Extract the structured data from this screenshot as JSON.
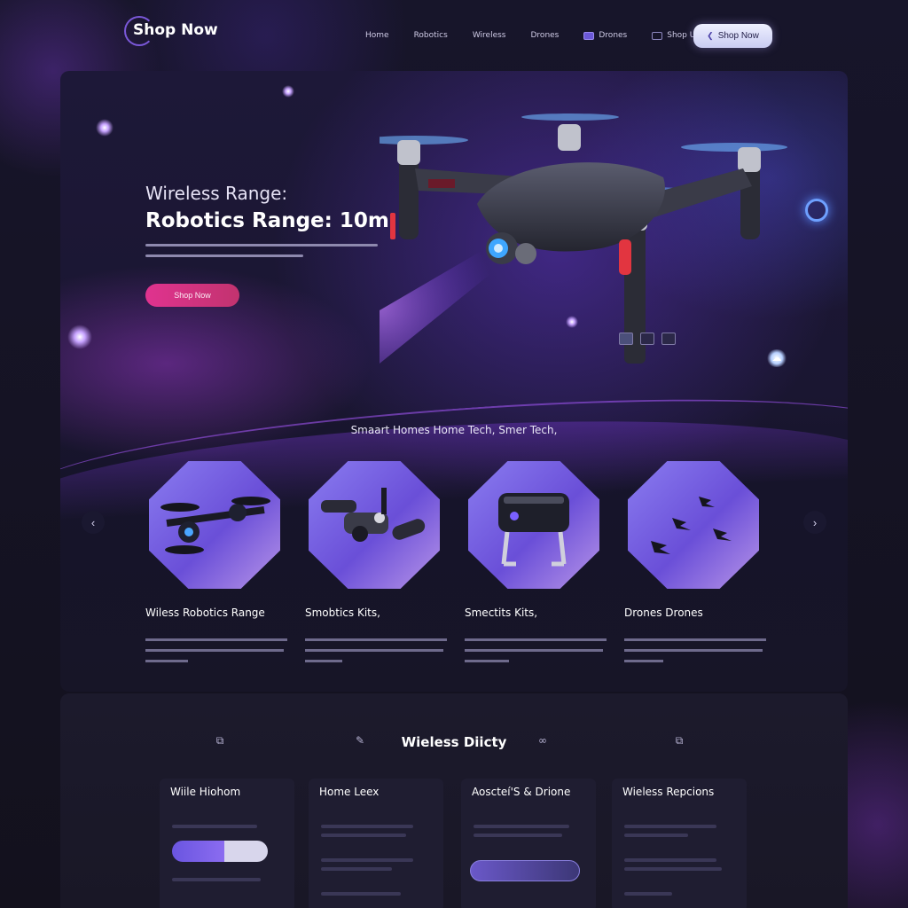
{
  "nav": {
    "logo": "Shop Now",
    "links": [
      "Home",
      "Robotics",
      "Wireless",
      "Drones",
      "Drones",
      "Shop Ultimate"
    ],
    "cta": "Shop Now"
  },
  "hero": {
    "subtitle": "Wireless Range:",
    "title": "Robotics Range: 10m",
    "cta": "Shop Now"
  },
  "products": {
    "section_title": "Smaart Homes Home Tech, Smer Tech,",
    "items": [
      {
        "title": "Wiless Robotics Range"
      },
      {
        "title": "Smobtics Kits,"
      },
      {
        "title": "Smectits Kits,"
      },
      {
        "title": "Drones Drones"
      }
    ]
  },
  "features": {
    "title": "Wieless Diicty",
    "columns": [
      {
        "title": "Wiile Hiohom"
      },
      {
        "title": "Home Leex"
      },
      {
        "title": "Aoscteí'S & Drione"
      },
      {
        "title": "Wieless Repcions"
      }
    ]
  },
  "colors": {
    "accent": "#6b58d6",
    "cta_pink": "#e0338f",
    "background": "#14121f"
  }
}
